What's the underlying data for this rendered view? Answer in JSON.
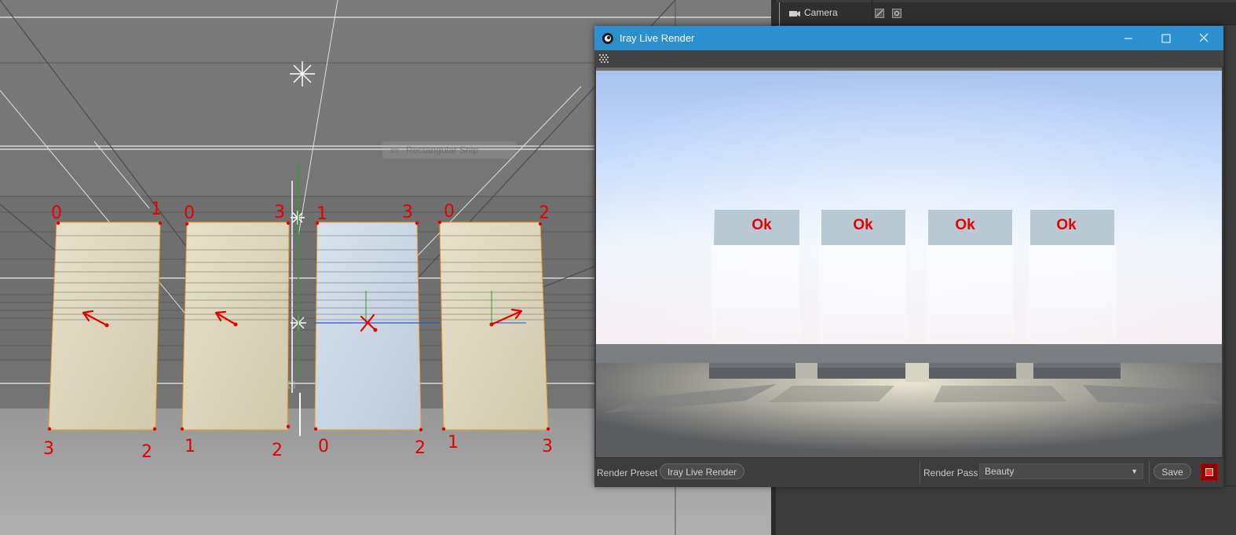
{
  "object_manager": {
    "camera_label": "Camera"
  },
  "viewport": {
    "snip_tooltip": "Rectangular Snip",
    "annotations": {
      "panel1": {
        "tl": "0",
        "tr": "1",
        "bl": "3",
        "br": "2"
      },
      "panel2": {
        "tl": "0",
        "tr": "3",
        "bl": "1",
        "br": "2"
      },
      "panel3": {
        "tl": "1",
        "tr": "3",
        "bl": "0",
        "br": "2"
      },
      "panel4": {
        "tl": "0",
        "tr": "2",
        "bl": "1",
        "br": "3"
      }
    }
  },
  "iray_window": {
    "title": "Iray Live Render",
    "render_labels": [
      "Ok",
      "Ok",
      "Ok",
      "Ok"
    ],
    "bottom": {
      "render_preset_label": "Render Preset",
      "render_preset_value": "Iray Live Render",
      "render_pass_label": "Render Pass",
      "render_pass_value": "Beauty",
      "save_label": "Save"
    }
  },
  "colors": {
    "annotation_red": "#e60000",
    "titlebar_blue": "#2c8fd0",
    "panel_beige": "#ddd8be",
    "panel_selected_blue": "#c5d2e0",
    "selection_orange": "#f0a030"
  }
}
